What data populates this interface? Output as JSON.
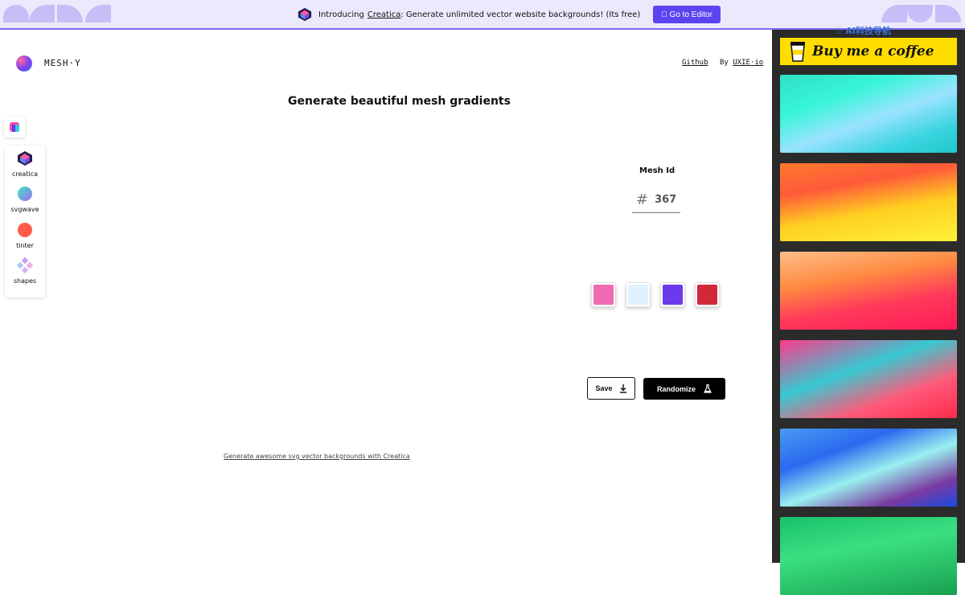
{
  "banner": {
    "intro": "Introducing",
    "link": "Creatica",
    "rest": ": Generate unlimited vector website backgrounds! (Its free)",
    "cta": " Go to Editor",
    "watermark": "☃ AI科技导航"
  },
  "header": {
    "brand": "MESH·Y",
    "github": "Github",
    "by_prefix": "By",
    "by_link": "UXIE·io"
  },
  "main": {
    "title": "Generate beautiful mesh gradients",
    "mesh_label": "Mesh Id",
    "mesh_hash": "#",
    "mesh_value": "367",
    "save": "Save",
    "randomize": "Randomize",
    "footer_link": "Generate awesome svg vector backgrounds with Creatica"
  },
  "sidebar": {
    "items": [
      {
        "label": "creatica",
        "icon": "creatica-icon"
      },
      {
        "label": "svgwave",
        "icon": "svgwave-icon"
      },
      {
        "label": "tinter",
        "icon": "tinter-icon"
      },
      {
        "label": "shapes",
        "icon": "shapes-icon"
      }
    ]
  },
  "swatches": [
    "#f06ab4",
    "#e0f2fd",
    "#6a3aeb",
    "#d1283a"
  ],
  "right": {
    "bmc": "Buy me a coffee",
    "thumbnails": [
      "linear-gradient(160deg, #2fe0c4 0%, #38f5d8 30%, #9be3ff 55%, #3ad4e0 80%, #1ec8c8 100%)",
      "linear-gradient(170deg, #ff7a2c 0%, #ff5a3a 30%, #ffd020 60%, #fff23a 100%)",
      "linear-gradient(170deg, #ffbe8a 0%, #ff8a40 35%, #ff3a5a 65%, #ff1a5a 100%)",
      "linear-gradient(160deg, #ff3a8a 0%, #38c8d0 40%, #ff5a7a 70%, #ff2a4a 100%)",
      "linear-gradient(160deg, #4a9af0 0%, #2a6af0 30%, #9af0f0 55%, #7a3aa0 80%, #1a4ae0 100%)",
      "linear-gradient(170deg, #18c06a 0%, #3ae080 40%, #18a050 100%)"
    ]
  }
}
